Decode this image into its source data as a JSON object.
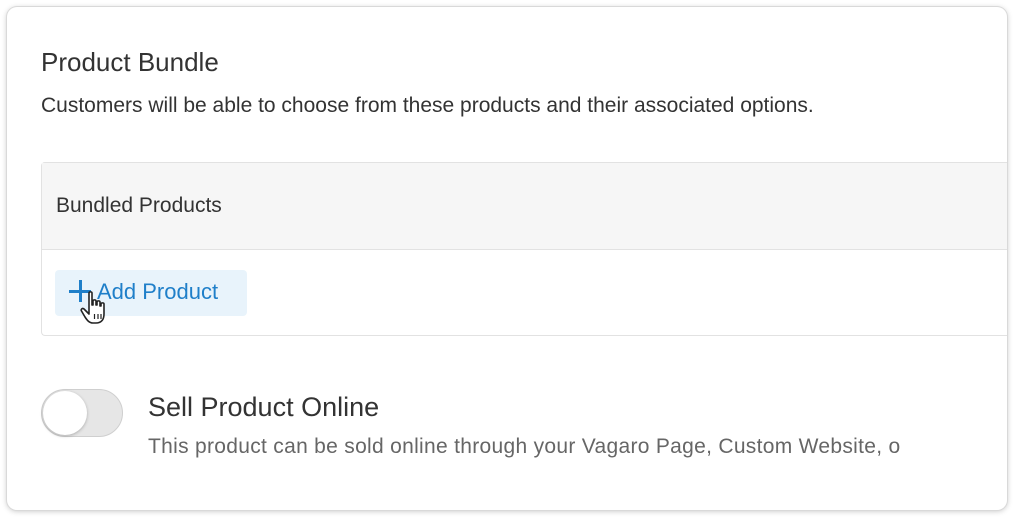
{
  "product_bundle": {
    "title": "Product Bundle",
    "description": "Customers will be able to choose from these products and their associated options."
  },
  "bundled_products": {
    "header": "Bundled Products",
    "add_button_label": "Add Product",
    "add_button_icon": "plus-icon"
  },
  "sell_online": {
    "toggle_state": "off",
    "title": "Sell Product Online",
    "description": "This product can be sold online through your Vagaro Page, Custom Website, o"
  },
  "colors": {
    "accent": "#1f7fc9",
    "button_bg": "#e8f3fb",
    "header_bg": "#f6f6f6",
    "text": "#333333",
    "muted_text": "#666666"
  }
}
